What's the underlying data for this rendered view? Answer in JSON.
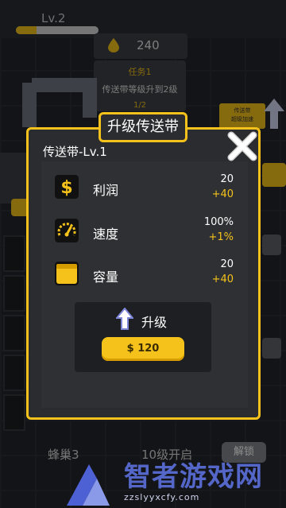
{
  "hud": {
    "level": "Lv.2",
    "xp_progress": 0.25,
    "resource_value": "240"
  },
  "task": {
    "title": "任务1",
    "description": "传送带等级升到2级",
    "progress": "1/2"
  },
  "side_card": {
    "line1": "传送带",
    "line2": "超级加速"
  },
  "dialog": {
    "title": "升级传送带",
    "item_title": "传送带-Lv.1",
    "stats": [
      {
        "name": "利润",
        "value": "20",
        "bonus": "+40",
        "icon": "dollar-icon"
      },
      {
        "name": "速度",
        "value": "100%",
        "bonus": "+1%",
        "icon": "speedometer-icon"
      },
      {
        "name": "容量",
        "value": "20",
        "bonus": "+40",
        "icon": "box-icon"
      }
    ],
    "upgrade_label": "升级",
    "price_label": "$ 120"
  },
  "bottom": {
    "hive_label": "蜂巢3",
    "unlock_level": "10级开启",
    "unlock_button": "解锁"
  },
  "watermark": {
    "text": "智者游戏网",
    "url": "zzslyyxcfy.com"
  },
  "colors": {
    "accent": "#f4c21a",
    "panel": "#2b2c30",
    "background": "#23262b"
  }
}
